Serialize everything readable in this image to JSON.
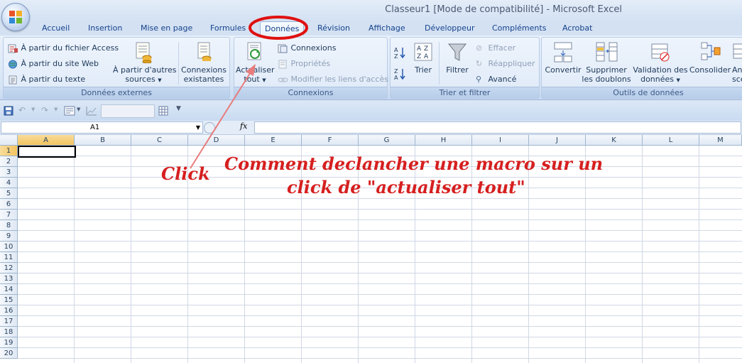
{
  "window": {
    "title": "Classeur1  [Mode de compatibilité] - Microsoft Excel"
  },
  "tabs": [
    "Accueil",
    "Insertion",
    "Mise en page",
    "Formules",
    "Données",
    "Révision",
    "Affichage",
    "Développeur",
    "Compléments",
    "Acrobat"
  ],
  "active_tab": "Données",
  "ribbon": {
    "external": {
      "access": "À partir du fichier Access",
      "web": "À partir du site Web",
      "text": "À partir du texte",
      "other_l1": "À partir d'autres",
      "other_l2": "sources",
      "existing_l1": "Connexions",
      "existing_l2": "existantes",
      "label": "Données externes"
    },
    "connections": {
      "refresh_l1": "Actualiser",
      "refresh_l2": "tout",
      "connexions": "Connexions",
      "properties": "Propriétés",
      "edit_links": "Modifier les liens d'accès",
      "label": "Connexions"
    },
    "sort": {
      "sort": "Trier",
      "filter": "Filtrer",
      "clear": "Effacer",
      "reapply": "Réappliquer",
      "advanced": "Avancé",
      "label": "Trier et filtrer"
    },
    "tools": {
      "convert": "Convertir",
      "remove_l1": "Supprimer",
      "remove_l2": "les doublons",
      "validation_l1": "Validation des",
      "validation_l2": "données",
      "consolidate": "Consolider",
      "analysis_l1": "An",
      "analysis_l2": "sce",
      "label": "Outils de données"
    }
  },
  "formula_bar": {
    "name_box": "A1",
    "fx": "fx",
    "formula": ""
  },
  "columns": [
    "A",
    "B",
    "C",
    "D",
    "E",
    "F",
    "G",
    "H",
    "I",
    "J",
    "K",
    "L",
    "M"
  ],
  "rows": [
    "1",
    "2",
    "3",
    "4",
    "5",
    "6",
    "7",
    "8",
    "9",
    "10",
    "11",
    "12",
    "13",
    "14",
    "15",
    "16",
    "17",
    "18",
    "19",
    "20"
  ],
  "annotation": {
    "click": "Click",
    "line1": "Comment declancher une macro sur un",
    "line2": "click de \"actualiser tout\""
  },
  "colors": {
    "annotation": "#d61f1f",
    "ribbon_text": "#15428b"
  }
}
